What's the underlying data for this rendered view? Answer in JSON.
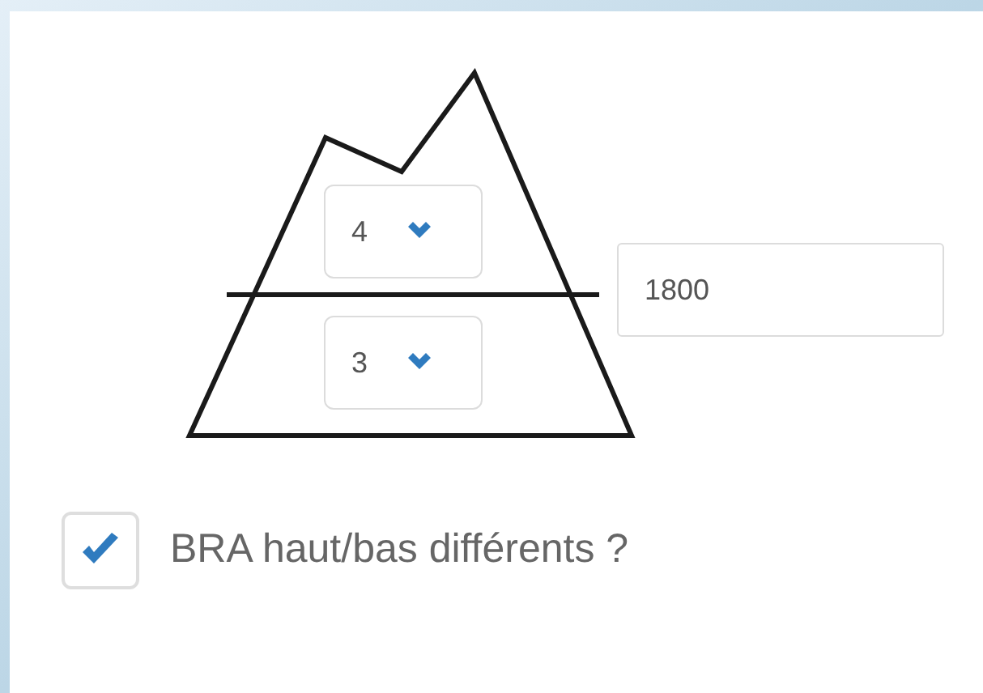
{
  "diagram": {
    "upper_select": {
      "value": "4"
    },
    "lower_select": {
      "value": "3"
    },
    "altitude_field": {
      "value": "1800"
    }
  },
  "checkbox": {
    "label": "BRA haut/bas différents ?",
    "checked": true
  }
}
